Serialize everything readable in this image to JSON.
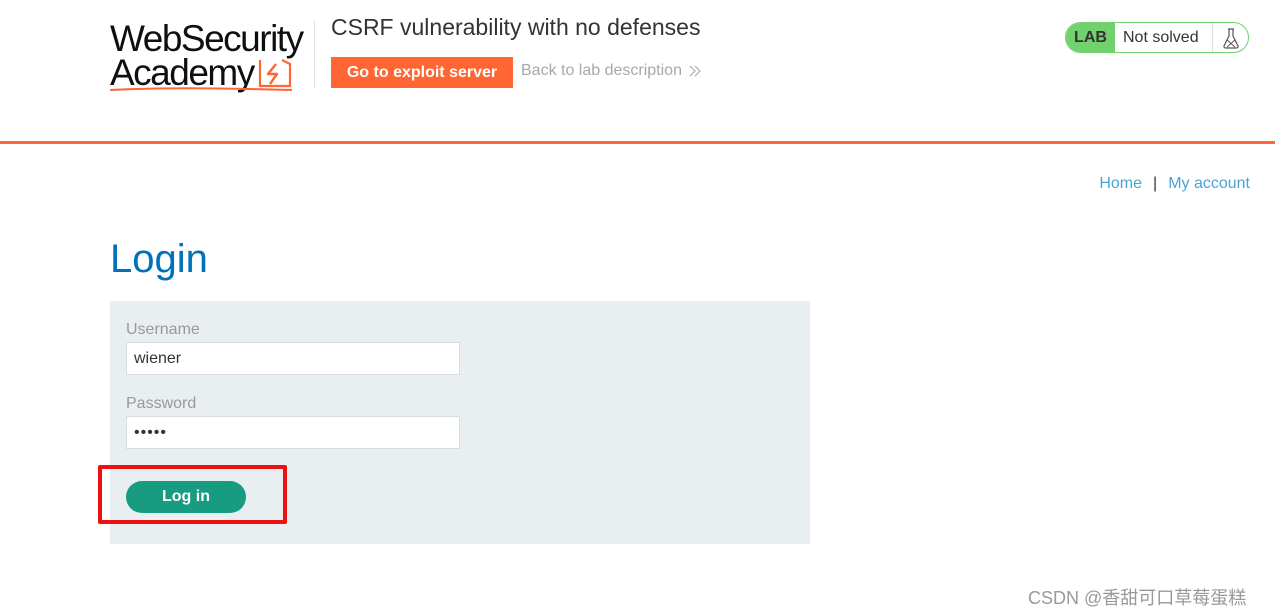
{
  "header": {
    "logo": {
      "line1": "WebSecurity",
      "line2": "Academy"
    },
    "lab_title": "CSRF vulnerability with no defenses",
    "exploit_button": "Go to exploit server",
    "back_link": "Back to lab description",
    "status": {
      "badge": "LAB",
      "text": "Not solved",
      "icon": "flask-icon"
    },
    "colors": {
      "accent": "#ff6633",
      "status_green": "#70d16d"
    }
  },
  "nav": {
    "items": [
      "Home",
      "My account"
    ],
    "separator": "|"
  },
  "main": {
    "title": "Login",
    "form": {
      "username_label": "Username",
      "username_value": "wiener",
      "password_label": "Password",
      "password_value": "•••••",
      "submit_label": "Log in"
    },
    "colors": {
      "title": "#0071bc",
      "button": "#179c82",
      "panel": "#e9eef0"
    }
  },
  "watermark": "CSDN @香甜可口草莓蛋糕"
}
